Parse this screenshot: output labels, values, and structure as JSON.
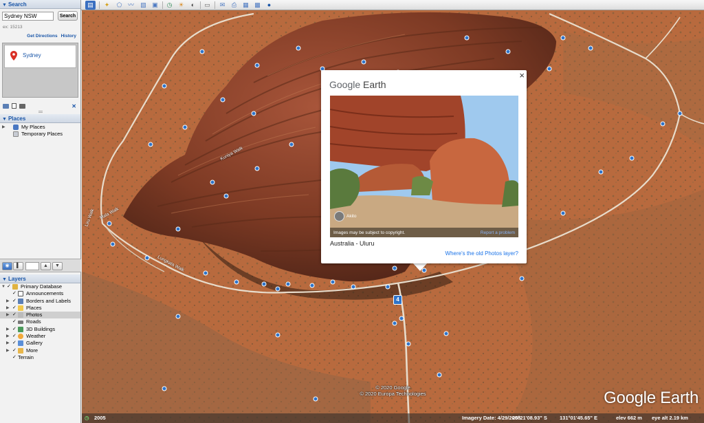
{
  "search": {
    "title": "Search",
    "input_value": "Sydney NSW",
    "button_label": "Search",
    "hint": "ex: 15213",
    "get_directions": "Get Directions",
    "history": "History",
    "result_name": "Sydney"
  },
  "places": {
    "title": "Places",
    "items": [
      {
        "label": "My Places"
      },
      {
        "label": "Temporary Places"
      }
    ]
  },
  "layers": {
    "title": "Layers",
    "items": [
      {
        "label": "Primary Database"
      },
      {
        "label": "Announcements"
      },
      {
        "label": "Borders and Labels"
      },
      {
        "label": "Places"
      },
      {
        "label": "Photos"
      },
      {
        "label": "Roads"
      },
      {
        "label": "3D Buildings"
      },
      {
        "label": "Weather"
      },
      {
        "label": "Gallery"
      },
      {
        "label": "More"
      },
      {
        "label": "Terrain"
      }
    ]
  },
  "popup": {
    "brand_google": "Google",
    "brand_earth": "Earth",
    "close": "×",
    "photo_author": "Akito",
    "copyright_note": "Images may be subject to copyright.",
    "report": "Report a problem",
    "place_name": "Australia - Uluru",
    "old_photos_link": "Where's the old Photos layer?"
  },
  "map": {
    "copyright_line1": "© 2020 Google",
    "copyright_line2": "© 2020 Europa Technologies",
    "logo": "Google Earth",
    "road_labels": [
      "Kuniya Walk",
      "Mala Walk",
      "Lungkata Walk",
      "Liru Walk"
    ],
    "road_shield": "4"
  },
  "status": {
    "year": "2005",
    "imagery_date": "Imagery Date: 4/29/2008",
    "latitude": "25°21'08.93\" S",
    "longitude": "131°01'45.65\" E",
    "elevation": "elev  662 m",
    "eye_alt": "eye alt   2.19 km"
  },
  "colors": {
    "accent": "#1a56a8",
    "desert": "#b5693c",
    "rock": "#8a3b22"
  }
}
